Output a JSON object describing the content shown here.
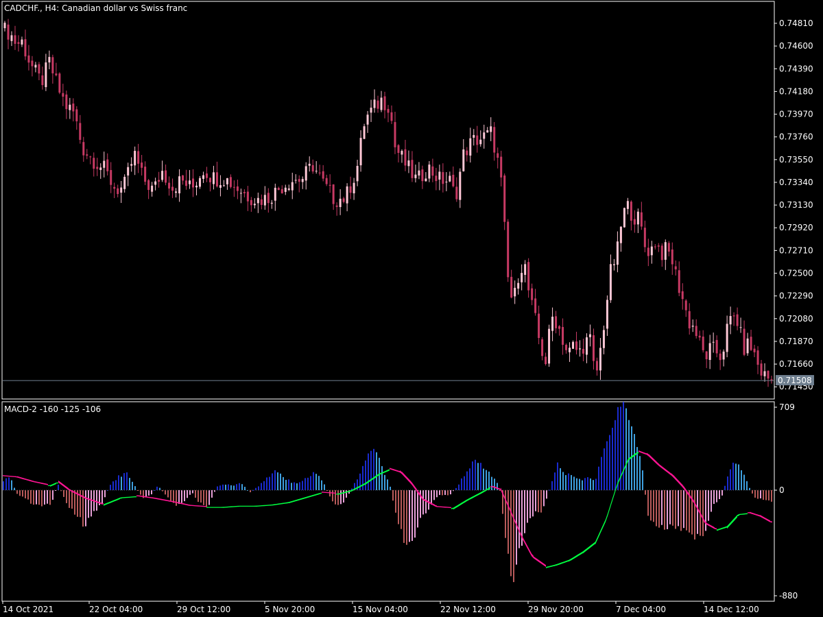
{
  "window": {
    "title": "CADCHF., H4:  Canadian dollar vs Swiss franc"
  },
  "colors": {
    "background": "#000000",
    "text": "#ffffff",
    "bull_candle": "#ffc8d6",
    "bear_candle": "#c83a64",
    "hist_up_strong": "#1a2bd0",
    "hist_up_weak": "#3ea0e0",
    "hist_down_strong": "#b85a5a",
    "hist_down_weak": "#e8a0d8",
    "ribbon_up": "#00ff40",
    "ribbon_down": "#ff1493",
    "price_line": "#6f7f8f",
    "price_tag_bg": "#6f7f8f"
  },
  "chart_data": [
    {
      "type": "candlestick",
      "title": "CADCHF., H4:  Canadian dollar vs Swiss franc",
      "y_ticks": [
        "0.74810",
        "0.74600",
        "0.74390",
        "0.74180",
        "0.73970",
        "0.73760",
        "0.73550",
        "0.73340",
        "0.73130",
        "0.72920",
        "0.72710",
        "0.72500",
        "0.72290",
        "0.72080",
        "0.71870",
        "0.71660",
        "0.71450"
      ],
      "ylim": [
        0.7135,
        0.75
      ],
      "current_price": "0.71508",
      "candle_count": 225,
      "close_anchors": [
        [
          0,
          0.7466
        ],
        [
          8,
          0.7476
        ],
        [
          16,
          0.747
        ],
        [
          24,
          0.7462
        ],
        [
          32,
          0.7464
        ],
        [
          44,
          0.7444
        ],
        [
          60,
          0.7426
        ],
        [
          72,
          0.7445
        ],
        [
          84,
          0.7422
        ],
        [
          96,
          0.7405
        ],
        [
          108,
          0.7398
        ],
        [
          120,
          0.7366
        ],
        [
          136,
          0.7355
        ],
        [
          152,
          0.7346
        ],
        [
          168,
          0.7328
        ],
        [
          180,
          0.7328
        ],
        [
          196,
          0.736
        ],
        [
          208,
          0.7338
        ],
        [
          224,
          0.7326
        ],
        [
          236,
          0.7345
        ],
        [
          252,
          0.7329
        ],
        [
          264,
          0.7336
        ],
        [
          280,
          0.7328
        ],
        [
          296,
          0.7346
        ],
        [
          312,
          0.7338
        ],
        [
          328,
          0.7338
        ],
        [
          344,
          0.733
        ],
        [
          360,
          0.7322
        ],
        [
          376,
          0.7318
        ],
        [
          392,
          0.732
        ],
        [
          408,
          0.7329
        ],
        [
          424,
          0.7336
        ],
        [
          440,
          0.7337
        ],
        [
          456,
          0.735
        ],
        [
          472,
          0.7332
        ],
        [
          488,
          0.7318
        ],
        [
          504,
          0.732
        ],
        [
          520,
          0.7345
        ],
        [
          532,
          0.7392
        ],
        [
          544,
          0.7402
        ],
        [
          556,
          0.741
        ],
        [
          568,
          0.7405
        ],
        [
          576,
          0.7367
        ],
        [
          592,
          0.735
        ],
        [
          608,
          0.7335
        ],
        [
          624,
          0.7348
        ],
        [
          640,
          0.7337
        ],
        [
          656,
          0.7335
        ],
        [
          664,
          0.732
        ],
        [
          676,
          0.736
        ],
        [
          688,
          0.7372
        ],
        [
          704,
          0.7375
        ],
        [
          716,
          0.738
        ],
        [
          724,
          0.736
        ],
        [
          732,
          0.7328
        ],
        [
          740,
          0.7247
        ],
        [
          748,
          0.722
        ],
        [
          756,
          0.725
        ],
        [
          764,
          0.7262
        ],
        [
          772,
          0.7228
        ],
        [
          780,
          0.7208
        ],
        [
          788,
          0.7182
        ],
        [
          796,
          0.7168
        ],
        [
          804,
          0.721
        ],
        [
          812,
          0.7205
        ],
        [
          820,
          0.719
        ],
        [
          828,
          0.7175
        ],
        [
          836,
          0.7183
        ],
        [
          844,
          0.7176
        ],
        [
          852,
          0.7185
        ],
        [
          860,
          0.719
        ],
        [
          868,
          0.7152
        ],
        [
          874,
          0.7172
        ],
        [
          882,
          0.721
        ],
        [
          890,
          0.725
        ],
        [
          900,
          0.727
        ],
        [
          908,
          0.7305
        ],
        [
          916,
          0.7312
        ],
        [
          924,
          0.7302
        ],
        [
          932,
          0.73
        ],
        [
          940,
          0.7275
        ],
        [
          948,
          0.727
        ],
        [
          956,
          0.728
        ],
        [
          964,
          0.7268
        ],
        [
          972,
          0.7272
        ],
        [
          980,
          0.7262
        ],
        [
          988,
          0.7242
        ],
        [
          996,
          0.7225
        ],
        [
          1004,
          0.7205
        ],
        [
          1012,
          0.72
        ],
        [
          1020,
          0.7185
        ],
        [
          1028,
          0.7172
        ],
        [
          1036,
          0.718
        ],
        [
          1044,
          0.7178
        ],
        [
          1052,
          0.7172
        ],
        [
          1060,
          0.7198
        ],
        [
          1068,
          0.721
        ],
        [
          1076,
          0.7205
        ],
        [
          1084,
          0.718
        ],
        [
          1092,
          0.7185
        ],
        [
          1100,
          0.7175
        ],
        [
          1108,
          0.716
        ],
        [
          1116,
          0.7155
        ],
        [
          1124,
          0.7151
        ]
      ]
    },
    {
      "type": "histogram",
      "title": "MACD-2 -160 -125 -106",
      "y_ticks": [
        "709",
        "0",
        "-880"
      ],
      "ylim": [
        -880,
        709
      ],
      "hist_anchors": [
        [
          4,
          80
        ],
        [
          16,
          110
        ],
        [
          24,
          -30
        ],
        [
          36,
          -60
        ],
        [
          48,
          -120
        ],
        [
          60,
          -140
        ],
        [
          76,
          -110
        ],
        [
          84,
          60
        ],
        [
          96,
          -100
        ],
        [
          112,
          -230
        ],
        [
          124,
          -290
        ],
        [
          136,
          -200
        ],
        [
          148,
          -120
        ],
        [
          160,
          40
        ],
        [
          172,
          110
        ],
        [
          184,
          160
        ],
        [
          196,
          40
        ],
        [
          208,
          -60
        ],
        [
          220,
          -40
        ],
        [
          230,
          40
        ],
        [
          240,
          -30
        ],
        [
          256,
          -120
        ],
        [
          268,
          -100
        ],
        [
          280,
          -20
        ],
        [
          292,
          -110
        ],
        [
          304,
          -140
        ],
        [
          316,
          30
        ],
        [
          328,
          50
        ],
        [
          340,
          40
        ],
        [
          352,
          60
        ],
        [
          364,
          -20
        ],
        [
          376,
          30
        ],
        [
          388,
          100
        ],
        [
          400,
          160
        ],
        [
          412,
          120
        ],
        [
          424,
          70
        ],
        [
          436,
          60
        ],
        [
          448,
          110
        ],
        [
          460,
          150
        ],
        [
          472,
          60
        ],
        [
          484,
          -90
        ],
        [
          496,
          -130
        ],
        [
          508,
          -40
        ],
        [
          520,
          90
        ],
        [
          528,
          200
        ],
        [
          536,
          300
        ],
        [
          548,
          330
        ],
        [
          556,
          200
        ],
        [
          568,
          60
        ],
        [
          576,
          -180
        ],
        [
          588,
          -400
        ],
        [
          596,
          -460
        ],
        [
          604,
          -380
        ],
        [
          616,
          -220
        ],
        [
          628,
          -120
        ],
        [
          640,
          -40
        ],
        [
          656,
          -40
        ],
        [
          668,
          40
        ],
        [
          680,
          160
        ],
        [
          692,
          240
        ],
        [
          704,
          200
        ],
        [
          716,
          130
        ],
        [
          728,
          40
        ],
        [
          736,
          -320
        ],
        [
          744,
          -700
        ],
        [
          748,
          -870
        ],
        [
          756,
          -560
        ],
        [
          768,
          -300
        ],
        [
          780,
          -200
        ],
        [
          792,
          -170
        ],
        [
          804,
          60
        ],
        [
          812,
          220
        ],
        [
          824,
          140
        ],
        [
          836,
          120
        ],
        [
          848,
          80
        ],
        [
          856,
          120
        ],
        [
          868,
          70
        ],
        [
          876,
          300
        ],
        [
          884,
          420
        ],
        [
          894,
          580
        ],
        [
          904,
          660
        ],
        [
          912,
          700
        ],
        [
          920,
          560
        ],
        [
          930,
          380
        ],
        [
          938,
          130
        ],
        [
          944,
          -200
        ],
        [
          956,
          -270
        ],
        [
          968,
          -330
        ],
        [
          980,
          -280
        ],
        [
          992,
          -300
        ],
        [
          1004,
          -380
        ],
        [
          1016,
          -390
        ],
        [
          1028,
          -360
        ],
        [
          1040,
          -120
        ],
        [
          1052,
          -60
        ],
        [
          1064,
          170
        ],
        [
          1074,
          250
        ],
        [
          1084,
          160
        ],
        [
          1092,
          30
        ],
        [
          1100,
          -60
        ],
        [
          1112,
          -70
        ],
        [
          1124,
          -100
        ]
      ],
      "signal_anchors": [
        [
          4,
          120
        ],
        [
          24,
          110
        ],
        [
          48,
          70
        ],
        [
          72,
          40
        ],
        [
          84,
          70
        ],
        [
          100,
          0
        ],
        [
          124,
          -70
        ],
        [
          150,
          -120
        ],
        [
          176,
          -60
        ],
        [
          200,
          -50
        ],
        [
          224,
          -70
        ],
        [
          252,
          -100
        ],
        [
          276,
          -130
        ],
        [
          300,
          -140
        ],
        [
          324,
          -140
        ],
        [
          348,
          -130
        ],
        [
          372,
          -130
        ],
        [
          396,
          -120
        ],
        [
          420,
          -100
        ],
        [
          444,
          -60
        ],
        [
          468,
          -20
        ],
        [
          492,
          -30
        ],
        [
          512,
          0
        ],
        [
          532,
          60
        ],
        [
          552,
          140
        ],
        [
          568,
          180
        ],
        [
          584,
          150
        ],
        [
          600,
          50
        ],
        [
          616,
          -80
        ],
        [
          636,
          -140
        ],
        [
          660,
          -150
        ],
        [
          680,
          -80
        ],
        [
          700,
          -20
        ],
        [
          716,
          30
        ],
        [
          730,
          0
        ],
        [
          744,
          -180
        ],
        [
          760,
          -390
        ],
        [
          776,
          -560
        ],
        [
          796,
          -640
        ],
        [
          810,
          -620
        ],
        [
          830,
          -580
        ],
        [
          850,
          -510
        ],
        [
          868,
          -430
        ],
        [
          884,
          -230
        ],
        [
          900,
          60
        ],
        [
          916,
          270
        ],
        [
          930,
          330
        ],
        [
          944,
          300
        ],
        [
          960,
          210
        ],
        [
          980,
          120
        ],
        [
          996,
          20
        ],
        [
          1012,
          -110
        ],
        [
          1028,
          -280
        ],
        [
          1044,
          -330
        ],
        [
          1060,
          -300
        ],
        [
          1076,
          -200
        ],
        [
          1092,
          -190
        ],
        [
          1108,
          -220
        ],
        [
          1124,
          -270
        ]
      ]
    }
  ],
  "x_ticks": [
    "14 Oct 2021",
    "22 Oct 04:00",
    "29 Oct 12:00",
    "5 Nov 20:00",
    "15 Nov 04:00",
    "22 Nov 12:00",
    "29 Nov 20:00",
    "7 Dec 04:00",
    "14 Dec 12:00"
  ]
}
